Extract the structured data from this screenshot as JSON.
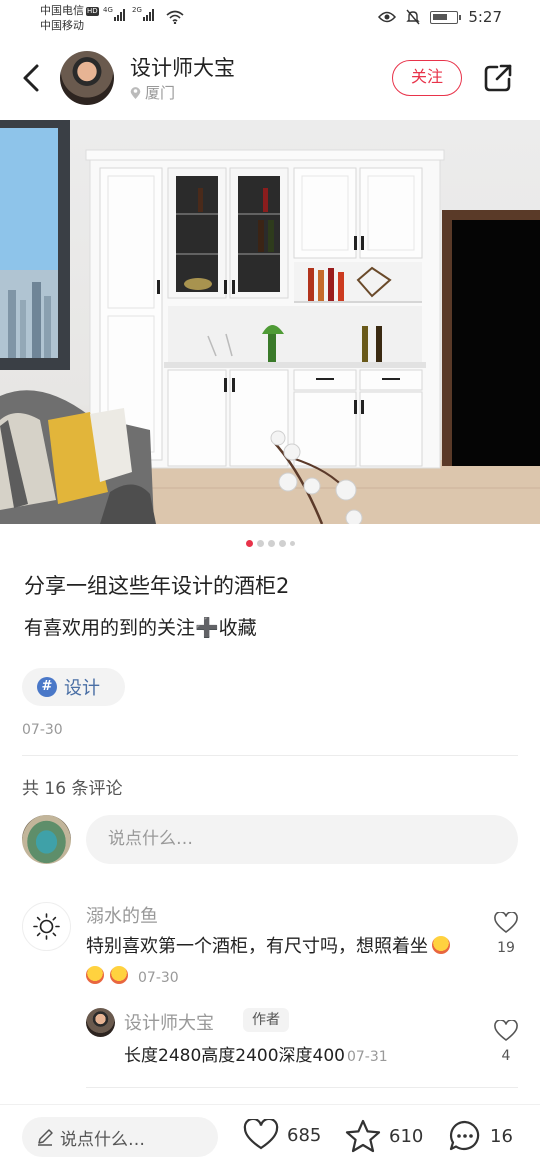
{
  "status_bar": {
    "carrier_1": "中国电信",
    "carrier_1_badge": "HD",
    "carrier_2": "中国移动",
    "signal_1_label": "4G",
    "signal_2_label": "2G",
    "time": "5:27"
  },
  "header": {
    "author_name": "设计师大宝",
    "location": "厦门",
    "follow_label": "关注"
  },
  "carousel": {
    "total_dots": 5,
    "active_index": 0
  },
  "post": {
    "title": "分享一组这些年设计的酒柜2",
    "description": "有喜欢用的到的关注➕收藏",
    "tag": "设计",
    "date": "07-30"
  },
  "comments": {
    "count_label": "共 16 条评论",
    "input_placeholder": "说点什么…",
    "items": [
      {
        "user": "溺水的鱼",
        "text": "特别喜欢第一个酒柜，有尺寸吗，想照着坐",
        "date": "07-30",
        "likes": "19",
        "replies": [
          {
            "user": "设计师大宝",
            "badge": "作者",
            "text": "长度2480高度2400深度400",
            "date": "07-31",
            "likes": "4"
          }
        ]
      }
    ]
  },
  "bottom_bar": {
    "input_label": "说点什么…",
    "likes": "685",
    "favorites": "610",
    "comments": "16"
  },
  "colors": {
    "accent": "#e8334a",
    "tag_text": "#4a6fa5",
    "muted": "#999999"
  }
}
